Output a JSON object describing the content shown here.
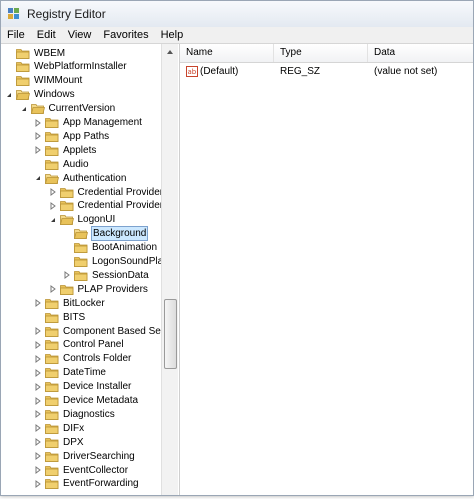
{
  "window": {
    "title": "Registry Editor"
  },
  "menu": [
    "File",
    "Edit",
    "View",
    "Favorites",
    "Help"
  ],
  "tree": [
    {
      "label": "WBEM",
      "level": 0,
      "expander": "none",
      "open": false
    },
    {
      "label": "WebPlatformInstaller",
      "level": 0,
      "expander": "none",
      "open": false
    },
    {
      "label": "WIMMount",
      "level": 0,
      "expander": "none",
      "open": false
    },
    {
      "label": "Windows",
      "level": 0,
      "expander": "expanded",
      "open": true
    },
    {
      "label": "CurrentVersion",
      "level": 1,
      "expander": "expanded",
      "open": true
    },
    {
      "label": "App Management",
      "level": 2,
      "expander": "collapsed",
      "open": false
    },
    {
      "label": "App Paths",
      "level": 2,
      "expander": "collapsed",
      "open": false
    },
    {
      "label": "Applets",
      "level": 2,
      "expander": "collapsed",
      "open": false
    },
    {
      "label": "Audio",
      "level": 2,
      "expander": "none",
      "open": false
    },
    {
      "label": "Authentication",
      "level": 2,
      "expander": "expanded",
      "open": true
    },
    {
      "label": "Credential Provider Fi",
      "level": 3,
      "expander": "collapsed",
      "open": false
    },
    {
      "label": "Credential Providers",
      "level": 3,
      "expander": "collapsed",
      "open": false
    },
    {
      "label": "LogonUI",
      "level": 3,
      "expander": "expanded",
      "open": true
    },
    {
      "label": "Background",
      "level": 4,
      "expander": "none",
      "open": true,
      "selected": true
    },
    {
      "label": "BootAnimation",
      "level": 4,
      "expander": "none",
      "open": false
    },
    {
      "label": "LogonSoundPlaye",
      "level": 4,
      "expander": "none",
      "open": false
    },
    {
      "label": "SessionData",
      "level": 4,
      "expander": "collapsed",
      "open": false
    },
    {
      "label": "PLAP Providers",
      "level": 3,
      "expander": "collapsed",
      "open": false
    },
    {
      "label": "BitLocker",
      "level": 2,
      "expander": "collapsed",
      "open": false
    },
    {
      "label": "BITS",
      "level": 2,
      "expander": "none",
      "open": false
    },
    {
      "label": "Component Based Servic",
      "level": 2,
      "expander": "collapsed",
      "open": false
    },
    {
      "label": "Control Panel",
      "level": 2,
      "expander": "collapsed",
      "open": false
    },
    {
      "label": "Controls Folder",
      "level": 2,
      "expander": "collapsed",
      "open": false
    },
    {
      "label": "DateTime",
      "level": 2,
      "expander": "collapsed",
      "open": false
    },
    {
      "label": "Device Installer",
      "level": 2,
      "expander": "collapsed",
      "open": false
    },
    {
      "label": "Device Metadata",
      "level": 2,
      "expander": "collapsed",
      "open": false
    },
    {
      "label": "Diagnostics",
      "level": 2,
      "expander": "collapsed",
      "open": false
    },
    {
      "label": "DIFx",
      "level": 2,
      "expander": "collapsed",
      "open": false
    },
    {
      "label": "DPX",
      "level": 2,
      "expander": "collapsed",
      "open": false
    },
    {
      "label": "DriverSearching",
      "level": 2,
      "expander": "collapsed",
      "open": false
    },
    {
      "label": "EventCollector",
      "level": 2,
      "expander": "collapsed",
      "open": false
    },
    {
      "label": "EventForwarding",
      "level": 2,
      "expander": "collapsed",
      "open": false
    }
  ],
  "list": {
    "columns": [
      "Name",
      "Type",
      "Data"
    ],
    "rows": [
      {
        "name": "(Default)",
        "type": "REG_SZ",
        "data": "(value not set)",
        "icon": "string-value-icon"
      }
    ]
  },
  "colors": {
    "folder": "#e8c25a",
    "selection": "#cce8ff",
    "ab_icon": "#c8442c"
  }
}
